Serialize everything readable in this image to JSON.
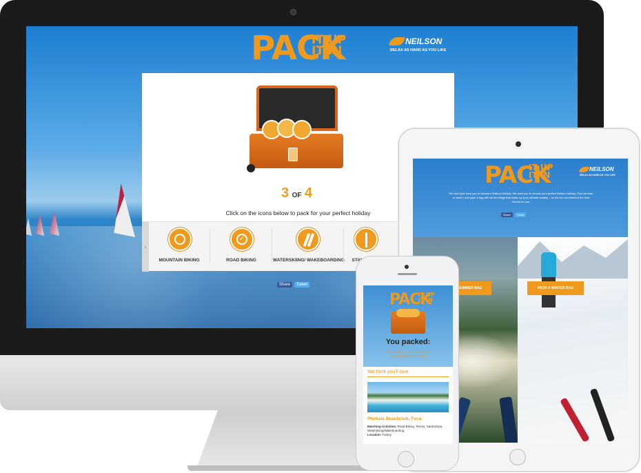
{
  "brand": {
    "pack": "PACK",
    "it_up": "IT UP",
    "it_in": "IT IN",
    "logo": "NEILSON",
    "tagline": "RELAX AS HARD AS YOU LIKE"
  },
  "desktop": {
    "progress_current": "3",
    "progress_of": "OF",
    "progress_total": "4",
    "instruction": "Click on the icons below to pack for your perfect holiday",
    "activities": [
      {
        "label": "MOUNTAIN BIKING",
        "icon": "mountain-bike-wheel-icon"
      },
      {
        "label": "ROAD BIKING",
        "icon": "road-bike-check-icon"
      },
      {
        "label": "WATERSKIING/ WAKEBOARDING",
        "icon": "waterski-icon"
      },
      {
        "label": "STAND UP PA",
        "icon": "paddleboard-icon"
      }
    ],
    "share": "Share",
    "tweet": "Tweet"
  },
  "tablet": {
    "intro": "We don't just want you to choose a Neilson holiday. We want you to choose your perfect Neilson holiday. Pick summer or winter, and pack a bag with all the things that make up your ultimate holiday – so we can recommend the best resorts for you.",
    "share": "Share",
    "tweet": "Tweet",
    "summer_btn": "PACK A SUMMER BAG",
    "winter_btn": "PACK A WINTER BAG"
  },
  "phone": {
    "you_packed": "You packed:",
    "packed_list": "Road Biking, Tennis, Sauna/Spa, Waterskiing/Wakeboarding",
    "we_think": "We think you'll love:",
    "resort_name": "Phokaia Beachclub, Foca",
    "matching_label": "Matching Activities:",
    "matching_value": "Road Biking, Tennis, Sauna/Spa, Waterskiing/Wakeboarding",
    "location_label": "Location:",
    "location_value": "Turkey"
  },
  "colors": {
    "accent": "#ef9a1d",
    "sky": "#3a8fd6",
    "sea": "#1f6fb8"
  }
}
